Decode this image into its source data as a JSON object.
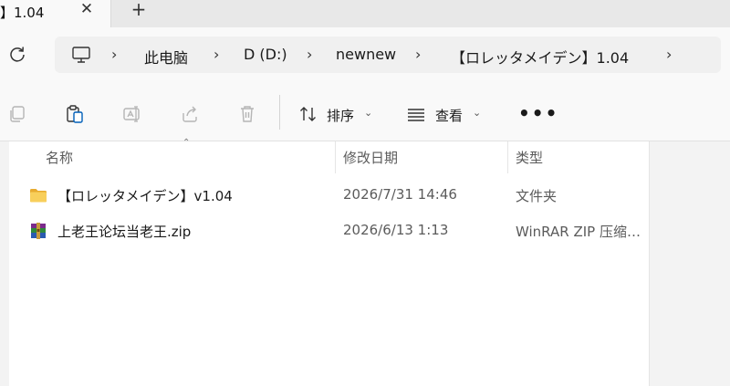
{
  "tab": {
    "title": "】1.04",
    "close_glyph": "✕",
    "new_glyph": "+"
  },
  "address": {
    "crumbs": [
      "此电脑",
      "D (D:)",
      "newnew",
      "【ロレッタメイデン】1.04"
    ],
    "separator": "›"
  },
  "toolbar": {
    "sort_label": "排序",
    "view_label": "查看",
    "more_label": "•••",
    "caret": "⌄"
  },
  "columns": {
    "name": "名称",
    "date": "修改日期",
    "type": "类型",
    "sort_indicator": "⌃"
  },
  "files": [
    {
      "name": "【ロレッタメイデン】v1.04",
      "date": "2026/7/31 14:46",
      "type": "文件夹",
      "icon": "folder-icon"
    },
    {
      "name": "上老王论坛当老王.zip",
      "date": "2026/6/13 1:13",
      "type": "WinRAR ZIP 压缩文件",
      "icon": "winrar-archive-icon"
    }
  ],
  "colors": {
    "folder": "#f4c04a",
    "accent": "#005fb8"
  }
}
